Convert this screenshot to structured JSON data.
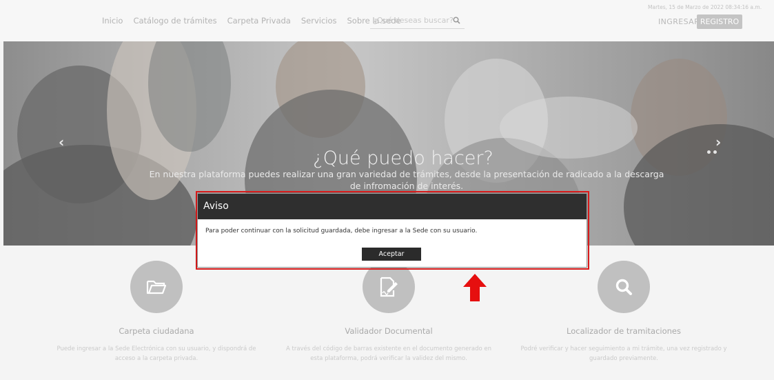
{
  "header": {
    "nav": [
      "Inicio",
      "Catálogo de trámites",
      "Carpeta Privada",
      "Servicios",
      "Sobre la sede"
    ],
    "search_placeholder": "¿Qué deseas buscar?",
    "search_icon": "search-icon",
    "datetime": "Martes, 15 de Marzo de 2022 08:34:16 a.m.",
    "login_label": "INGRESAR",
    "register_label": "REGISTRO"
  },
  "hero": {
    "title": "¿Qué puedo hacer?",
    "subtitle": "En nuestra plataforma puedes realizar una gran variedad de trámites, desde la presentación de radicado a la descarga de infromación de interés.",
    "prev": "‹",
    "next": "›"
  },
  "cards": [
    {
      "title": "Carpeta ciudadana",
      "text": "Puede ingresar a la Sede Electrónica con su usuario, y dispondrá de acceso a la carpeta privada.",
      "icon": "folder-icon"
    },
    {
      "title": "Validador Documental",
      "text": "A través del código de barras existente en el documento generado en esta plataforma, podrá verificar la validez del mismo.",
      "icon": "document-edit-icon"
    },
    {
      "title": "Localizador de tramitaciones",
      "text": "Podré verificar y hacer seguimiento a mi trámite, una vez registrado y guardado previamente.",
      "icon": "search-icon"
    }
  ],
  "modal": {
    "title": "Aviso",
    "message": "Para poder continuar con la solicitud guardada, debe ingresar a la Sede con su usuario.",
    "accept_label": "Aceptar"
  },
  "colors": {
    "modal_header": "#2f2f2f",
    "highlight": "#e11b1b",
    "button": "#2b2b2b"
  }
}
